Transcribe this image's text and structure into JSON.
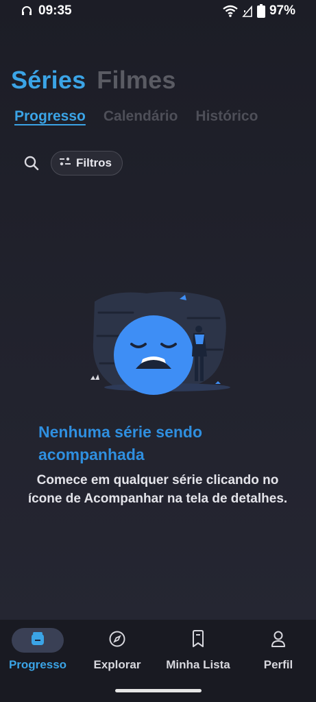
{
  "status_bar": {
    "time": "09:35",
    "battery": "97%"
  },
  "header": {
    "main_tabs": [
      {
        "label": "Séries",
        "active": true
      },
      {
        "label": "Filmes",
        "active": false
      }
    ],
    "sub_tabs": [
      {
        "label": "Progresso",
        "active": true
      },
      {
        "label": "Calendário",
        "active": false
      },
      {
        "label": "Histórico",
        "active": false
      }
    ]
  },
  "toolbar": {
    "search_icon": "search-icon",
    "filter_label": "Filtros"
  },
  "empty_state": {
    "title": "Nenhuma série sendo acompanhada",
    "description": "Comece em qualquer série clicando no ícone de Acompanhar na tela de detalhes."
  },
  "bottom_nav": {
    "items": [
      {
        "label": "Progresso",
        "icon": "progress-icon",
        "active": true
      },
      {
        "label": "Explorar",
        "icon": "compass-icon",
        "active": false
      },
      {
        "label": "Minha Lista",
        "icon": "bookmark-icon",
        "active": false
      },
      {
        "label": "Perfil",
        "icon": "person-icon",
        "active": false
      }
    ]
  },
  "colors": {
    "accent": "#3ba4e6",
    "background": "#1f2029",
    "nav_background": "#191a22"
  }
}
